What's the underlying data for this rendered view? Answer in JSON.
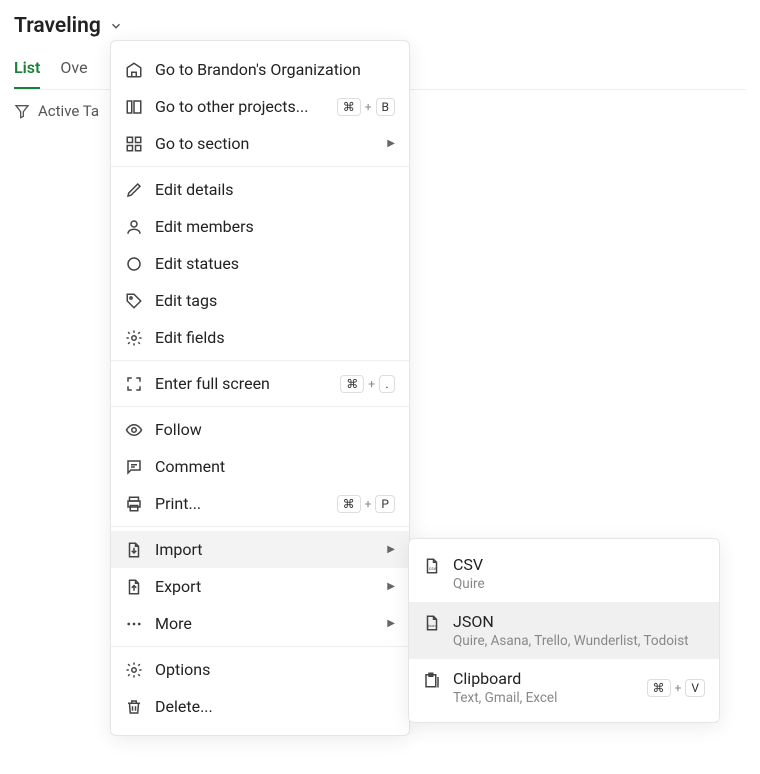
{
  "header": {
    "title": "Traveling"
  },
  "tabs": {
    "list": "List",
    "overview_truncated": "Ove"
  },
  "filter": {
    "label": "Active Ta"
  },
  "menu": {
    "go_org": "Go to Brandon's Organization",
    "go_other": "Go to other projects...",
    "go_other_shortcut": {
      "mod": "⌘",
      "key": "B"
    },
    "go_section": "Go to section",
    "edit_details": "Edit details",
    "edit_members": "Edit members",
    "edit_statues": "Edit statues",
    "edit_tags": "Edit tags",
    "edit_fields": "Edit fields",
    "fullscreen": "Enter full screen",
    "fullscreen_shortcut": {
      "mod": "⌘",
      "key": "."
    },
    "follow": "Follow",
    "comment": "Comment",
    "print": "Print...",
    "print_shortcut": {
      "mod": "⌘",
      "key": "P"
    },
    "import": "Import",
    "export": "Export",
    "more": "More",
    "options": "Options",
    "delete": "Delete..."
  },
  "submenu": {
    "csv": {
      "title": "CSV",
      "sub": "Quire"
    },
    "json": {
      "title": "JSON",
      "sub": "Quire, Asana, Trello, Wunderlist, Todoist"
    },
    "clipboard": {
      "title": "Clipboard",
      "sub": "Text, Gmail, Excel",
      "shortcut": {
        "mod": "⌘",
        "key": "V"
      }
    }
  }
}
